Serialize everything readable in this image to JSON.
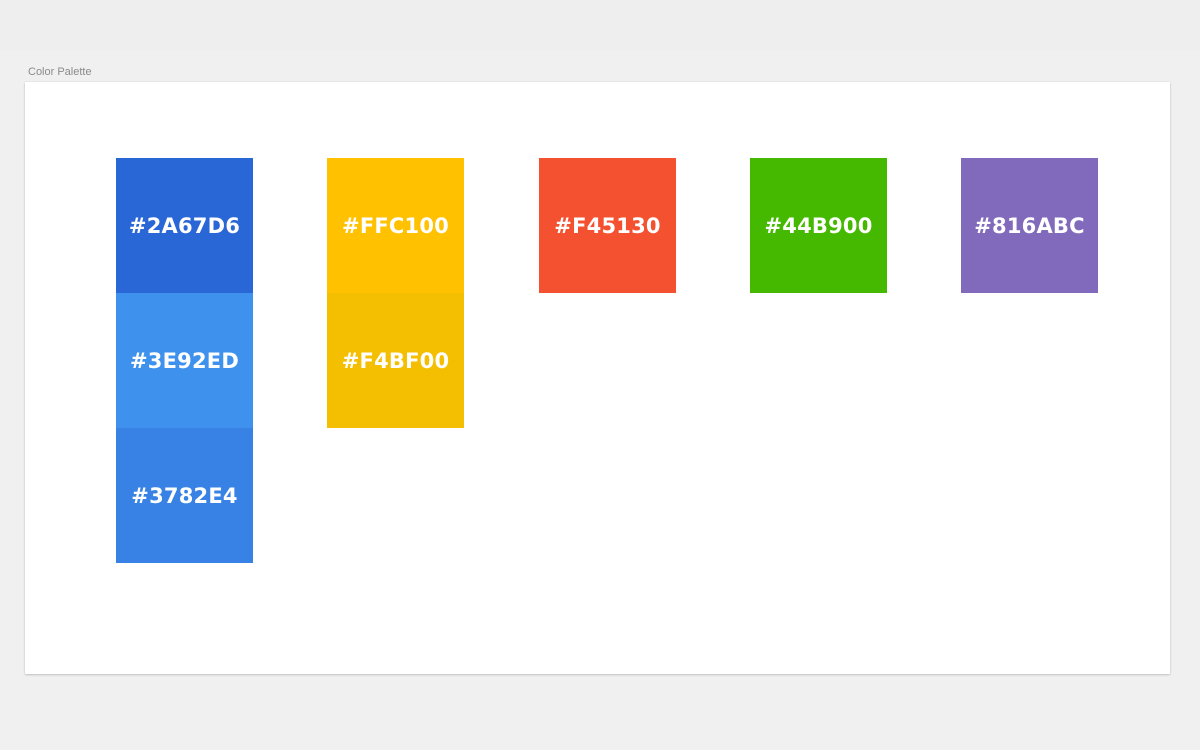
{
  "artboard": {
    "title": "Color Palette"
  },
  "columns": [
    {
      "name": "blue",
      "swatches": [
        {
          "label": "#2A67D6",
          "color": "#2A67D6"
        },
        {
          "label": "#3E92ED",
          "color": "#3E92ED"
        },
        {
          "label": "#3782E4",
          "color": "#3782E4"
        }
      ]
    },
    {
      "name": "yellow",
      "swatches": [
        {
          "label": "#FFC100",
          "color": "#FFC100"
        },
        {
          "label": "#F4BF00",
          "color": "#F4BF00"
        }
      ]
    },
    {
      "name": "orange",
      "swatches": [
        {
          "label": "#F45130",
          "color": "#F45130"
        }
      ]
    },
    {
      "name": "green",
      "swatches": [
        {
          "label": "#44B900",
          "color": "#44B900"
        }
      ]
    },
    {
      "name": "purple",
      "swatches": [
        {
          "label": "#816ABC",
          "color": "#816ABC"
        }
      ]
    }
  ]
}
